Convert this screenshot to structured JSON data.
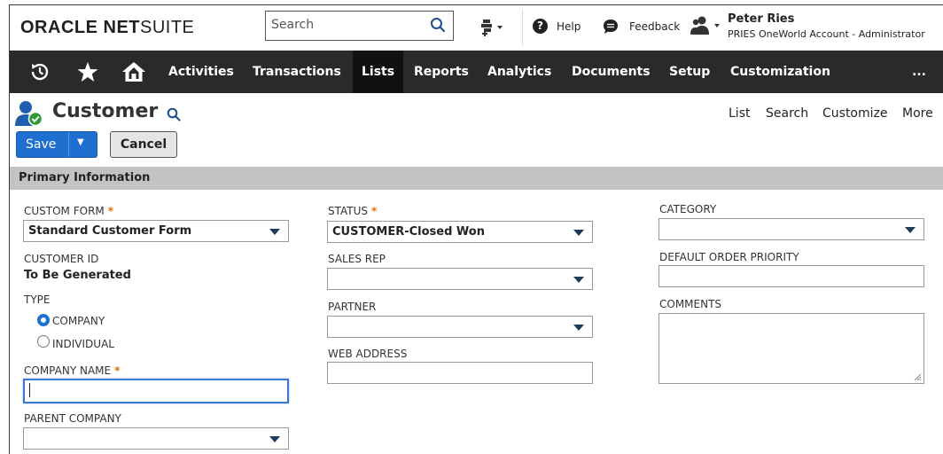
{
  "header": {
    "logo_bold": "ORACLE NET",
    "logo_light": "SUITE",
    "search_placeholder": "Search",
    "help_label": "Help",
    "feedback_label": "Feedback",
    "user_name": "Peter Ries",
    "user_account": "PRIES OneWorld Account - Administrator"
  },
  "nav": {
    "items": [
      "Activities",
      "Transactions",
      "Lists",
      "Reports",
      "Analytics",
      "Documents",
      "Setup",
      "Customization"
    ],
    "active": "Lists",
    "more": "..."
  },
  "page": {
    "title": "Customer",
    "links": [
      "List",
      "Search",
      "Customize",
      "More"
    ],
    "save_label": "Save",
    "cancel_label": "Cancel",
    "section_title": "Primary Information"
  },
  "form": {
    "custom_form_label": "CUSTOM FORM",
    "custom_form_value": "Standard Customer Form",
    "customer_id_label": "CUSTOMER ID",
    "customer_id_value": "To Be Generated",
    "type_label": "TYPE",
    "type_company": "COMPANY",
    "type_individual": "INDIVIDUAL",
    "company_name_label": "COMPANY NAME",
    "company_name_value": "",
    "parent_company_label": "PARENT COMPANY",
    "parent_company_value": "",
    "status_label": "STATUS",
    "status_value": "CUSTOMER-Closed Won",
    "sales_rep_label": "SALES REP",
    "sales_rep_value": "",
    "partner_label": "PARTNER",
    "partner_value": "",
    "web_address_label": "WEB ADDRESS",
    "web_address_value": "",
    "category_label": "CATEGORY",
    "category_value": "",
    "default_order_priority_label": "DEFAULT ORDER PRIORITY",
    "default_order_priority_value": "",
    "comments_label": "COMMENTS",
    "comments_value": ""
  },
  "colors": {
    "nav_bg": "#2a2a2a",
    "save_blue": "#1f6fd0",
    "required_orange": "#e07000",
    "section_gray": "#c3c3c3"
  }
}
